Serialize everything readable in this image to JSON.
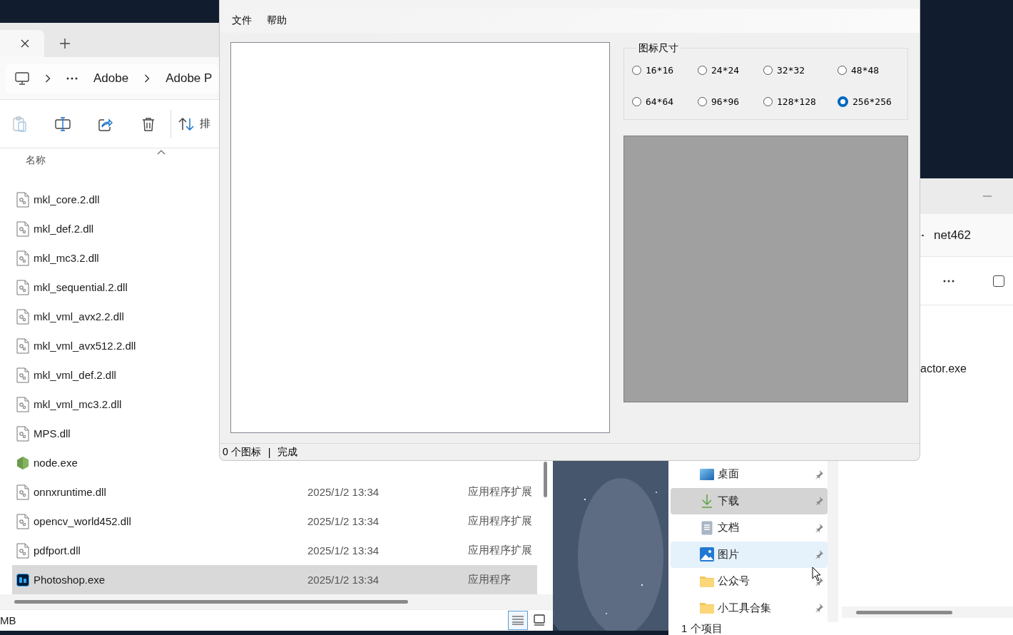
{
  "explorer_left": {
    "breadcrumb": [
      "Adobe",
      "Adobe P"
    ],
    "sort_label": "排",
    "column_header": "名称",
    "files": [
      {
        "name": "mkl_core.2.dll",
        "kind": "dll",
        "selected": false
      },
      {
        "name": "mkl_def.2.dll",
        "kind": "dll",
        "selected": false
      },
      {
        "name": "mkl_mc3.2.dll",
        "kind": "dll",
        "selected": false
      },
      {
        "name": "mkl_sequential.2.dll",
        "kind": "dll",
        "selected": false
      },
      {
        "name": "mkl_vml_avx2.2.dll",
        "kind": "dll",
        "selected": false
      },
      {
        "name": "mkl_vml_avx512.2.dll",
        "kind": "dll",
        "selected": false
      },
      {
        "name": "mkl_vml_def.2.dll",
        "kind": "dll",
        "selected": false
      },
      {
        "name": "mkl_vml_mc3.2.dll",
        "kind": "dll",
        "selected": false
      },
      {
        "name": "MPS.dll",
        "kind": "dll",
        "selected": false
      },
      {
        "name": "node.exe",
        "kind": "node",
        "selected": false
      },
      {
        "name": "onnxruntime.dll",
        "kind": "dll",
        "date": "2025/1/2 13:34",
        "type": "应用程序扩展",
        "selected": false
      },
      {
        "name": "opencv_world452.dll",
        "kind": "dll",
        "date": "2025/1/2 13:34",
        "type": "应用程序扩展",
        "selected": false
      },
      {
        "name": "pdfport.dll",
        "kind": "dll",
        "date": "2025/1/2 13:34",
        "type": "应用程序扩展",
        "selected": false
      },
      {
        "name": "Photoshop.exe",
        "kind": "ps",
        "date": "2025/1/2 13:34",
        "type": "应用程序",
        "selected": true
      }
    ],
    "view_buttons": [
      {
        "kind": "details",
        "selected": true
      },
      {
        "kind": "tiles",
        "selected": false
      }
    ],
    "status": "MB"
  },
  "explorer_right": {
    "breadcrumb": "net462",
    "file_name": "actor.exe",
    "nav": [
      {
        "label": "桌面",
        "kind": "desktop",
        "selected": false,
        "hovered": false
      },
      {
        "label": "下载",
        "kind": "download",
        "selected": true,
        "hovered": false
      },
      {
        "label": "文档",
        "kind": "document",
        "selected": false,
        "hovered": false
      },
      {
        "label": "图片",
        "kind": "picture",
        "selected": false,
        "hovered": true
      },
      {
        "label": "公众号",
        "kind": "folder",
        "selected": false,
        "hovered": false
      },
      {
        "label": "小工具合集",
        "kind": "folder",
        "selected": false,
        "hovered": false
      }
    ],
    "status": "1 个项目"
  },
  "icon_extractor": {
    "menu": [
      "文件",
      "帮助"
    ],
    "size_group": {
      "title": "图标尺寸",
      "options": [
        {
          "label": "16*16",
          "selected": false
        },
        {
          "label": "24*24",
          "selected": false
        },
        {
          "label": "32*32",
          "selected": false
        },
        {
          "label": "48*48",
          "selected": false
        },
        {
          "label": "64*64",
          "selected": false
        },
        {
          "label": "96*96",
          "selected": false
        },
        {
          "label": "128*128",
          "selected": false
        },
        {
          "label": "256*256",
          "selected": true
        }
      ]
    },
    "status": {
      "count": "0 个图标",
      "separator": "|",
      "message": "完成"
    }
  }
}
